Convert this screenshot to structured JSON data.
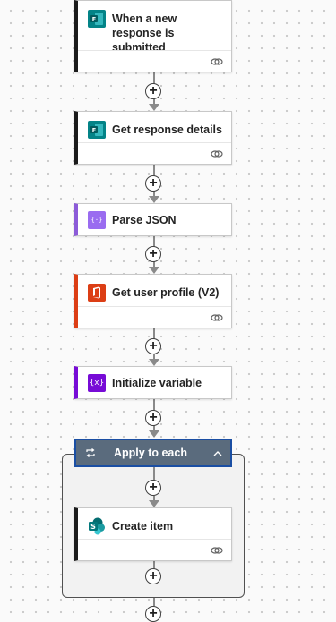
{
  "canvas": {
    "background": "#fafafa"
  },
  "steps": {
    "trigger": {
      "title": "When a new response is submitted",
      "icon": "forms-icon",
      "accent": "#1b1b1b",
      "icon_color": "#038387"
    },
    "get_response": {
      "title": "Get response details",
      "icon": "forms-icon",
      "accent": "#1b1b1b",
      "icon_color": "#038387"
    },
    "parse_json": {
      "title": "Parse JSON",
      "icon": "data-operation-icon",
      "icon_glyph": "{·}",
      "accent": "#8c5bd8",
      "icon_color": "#9a6cf0"
    },
    "user_profile": {
      "title": "Get user profile (V2)",
      "icon": "office365-icon",
      "accent": "#dc3e15",
      "icon_color": "#dc3e15"
    },
    "init_variable": {
      "title": "Initialize variable",
      "icon": "variable-icon",
      "icon_glyph": "{x}",
      "accent": "#770bd6",
      "icon_color": "#770bd6"
    },
    "apply_each": {
      "title": "Apply to each",
      "icon": "loop-icon",
      "header_color": "#5a6b7d",
      "border_color": "#1a4ea3"
    },
    "create_item": {
      "title": "Create item",
      "icon": "sharepoint-icon",
      "accent": "#1b1b1b",
      "icon_color": "#038387"
    }
  }
}
